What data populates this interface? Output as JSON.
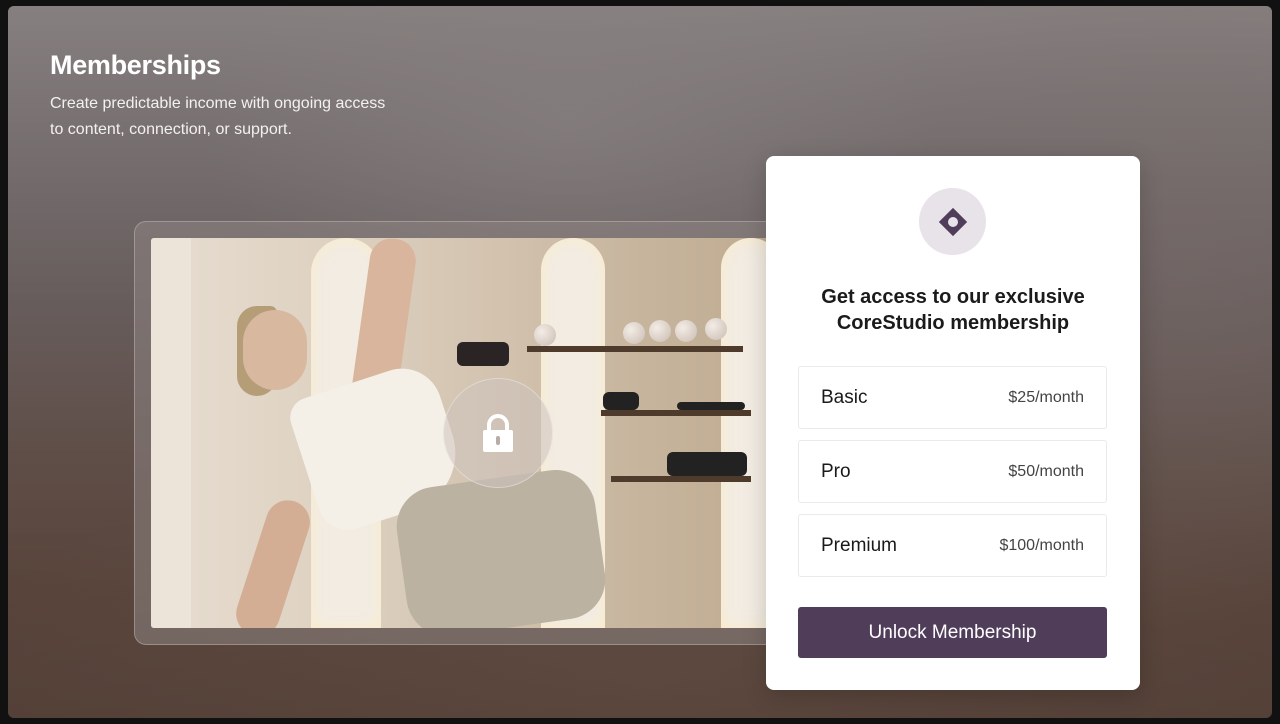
{
  "header": {
    "title": "Memberships",
    "subtitle": "Create predictable income with ongoing access to content, connection, or support."
  },
  "media": {
    "lock_icon": "lock-icon"
  },
  "card": {
    "logo_icon": "diamond-icon",
    "title": "Get access to our exclusive CoreStudio membership",
    "plans": [
      {
        "name": "Basic",
        "price": "$25/month"
      },
      {
        "name": "Pro",
        "price": "$50/month"
      },
      {
        "name": "Premium",
        "price": "$100/month"
      }
    ],
    "cta_label": "Unlock Membership"
  },
  "colors": {
    "accent": "#4f3d5a",
    "logo_bg": "#e8e2e9"
  }
}
